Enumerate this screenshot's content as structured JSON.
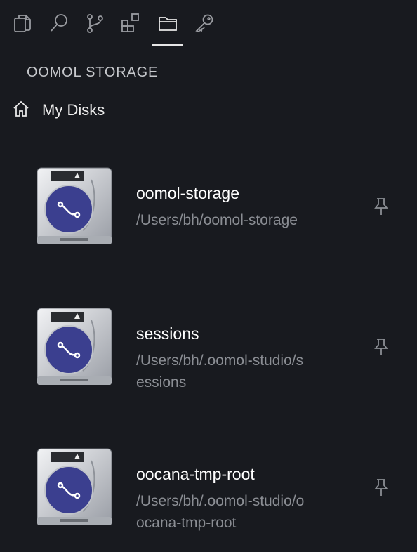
{
  "activity_bar": {
    "icons": [
      "explorer-icon",
      "search-icon",
      "source-control-icon",
      "extensions-icon",
      "storage-folder-icon",
      "key-icon"
    ],
    "active": "storage-folder-icon"
  },
  "storage": {
    "section_title": "OOMOL STORAGE",
    "home_label": "My Disks",
    "disks": [
      {
        "name": "oomol-storage",
        "path": "/Users/bh/oomol-storage"
      },
      {
        "name": "sessions",
        "path": "/Users/bh/.oomol-studio/sessions"
      },
      {
        "name": "oocana-tmp-root",
        "path": "/Users/bh/.oomol-studio/oocana-tmp-root"
      }
    ]
  },
  "colors": {
    "background": "#181a1f",
    "disk_label": "#3b3f8f",
    "path_text": "#8b8e94"
  }
}
